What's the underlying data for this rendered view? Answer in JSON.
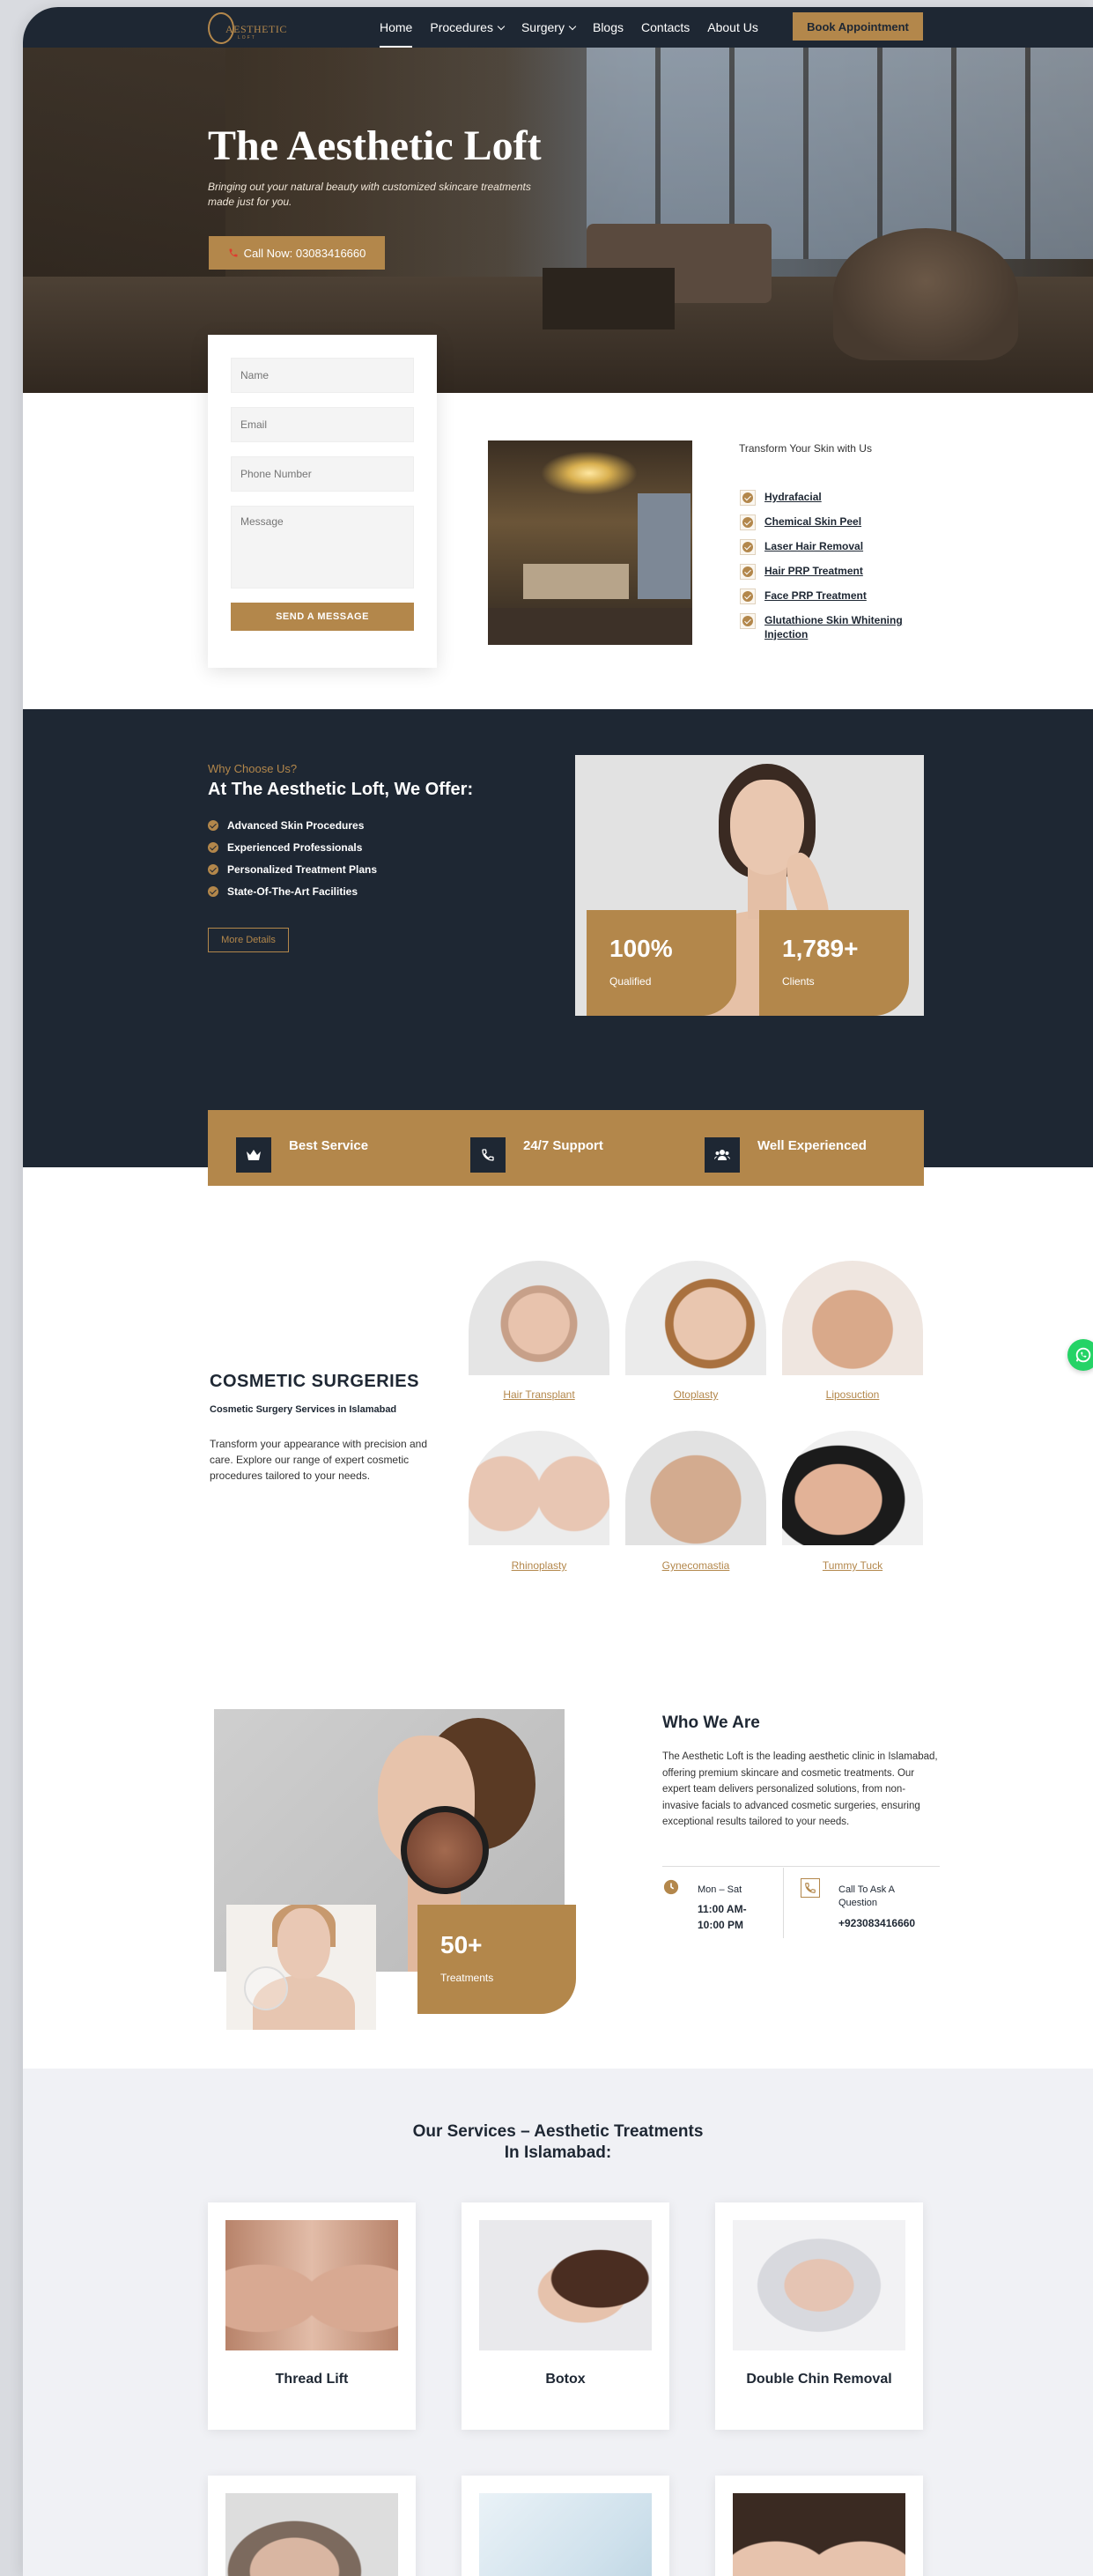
{
  "nav": {
    "logo_text": "AESTHETIC",
    "logo_sub": "LOFT",
    "items": [
      {
        "label": "Home",
        "dropdown": false,
        "active": true
      },
      {
        "label": "Procedures",
        "dropdown": true,
        "active": false
      },
      {
        "label": "Surgery",
        "dropdown": true,
        "active": false
      },
      {
        "label": "Blogs",
        "dropdown": false,
        "active": false
      },
      {
        "label": "Contacts",
        "dropdown": false,
        "active": false
      },
      {
        "label": "About Us",
        "dropdown": false,
        "active": false
      }
    ],
    "book_button": "Book Appointment"
  },
  "hero": {
    "title": "The Aesthetic Loft",
    "subtitle": "Bringing out your natural beauty with customized skincare treatments made just for you.",
    "call_button": "Call Now: 03083416660"
  },
  "form": {
    "name_placeholder": "Name",
    "email_placeholder": "Email",
    "phone_placeholder": "Phone Number",
    "message_placeholder": "Message",
    "send_button": "SEND A MESSAGE"
  },
  "transform": {
    "title": "Transform Your Skin with Us",
    "items": [
      "Hydrafacial",
      "Chemical Skin Peel",
      "Laser Hair Removal",
      "Hair PRP Treatment",
      "Face PRP Treatment",
      "Glutathione Skin Whitening Injection"
    ]
  },
  "why": {
    "eyebrow": "Why Choose Us?",
    "title": "At The Aesthetic Loft, We Offer:",
    "items": [
      "Advanced Skin Procedures",
      "Experienced Professionals",
      "Personalized Treatment Plans",
      "State-Of-The-Art Facilities"
    ],
    "more_button": "More Details",
    "stats": [
      {
        "value": "100%",
        "label": "Qualified"
      },
      {
        "value": "1,789+",
        "label": "Clients"
      }
    ]
  },
  "features": [
    {
      "label": "Best Service",
      "icon": "crown-icon"
    },
    {
      "label": "24/7 Support",
      "icon": "phone-icon"
    },
    {
      "label": "Well Experienced",
      "icon": "users-icon"
    }
  ],
  "surgeries": {
    "title": "COSMETIC SURGERIES",
    "subtitle": "Cosmetic Surgery Services in Islamabad",
    "description": "Transform your appearance with precision and care. Explore our range of expert cosmetic procedures tailored to your needs.",
    "items": [
      "Hair Transplant",
      "Otoplasty",
      "Liposuction",
      "Rhinoplasty",
      "Gynecomastia",
      "Tummy Tuck"
    ]
  },
  "who": {
    "title": "Who We Are",
    "description": "The Aesthetic Loft is the leading aesthetic clinic in Islamabad, offering premium skincare and cosmetic treatments. Our expert team delivers personalized solutions, from non-invasive facials to advanced cosmetic surgeries, ensuring exceptional results tailored to your needs.",
    "stat_value": "50+",
    "stat_label": "Treatments",
    "hours_label": "Mon – Sat",
    "hours_value": "11:00 AM-10:00 PM",
    "call_label": "Call To Ask A Question",
    "call_value": "+923083416660"
  },
  "services": {
    "title_line1": "Our Services – Aesthetic Treatments",
    "title_line2": "In Islamabad:",
    "items": [
      "Thread Lift",
      "Botox",
      "Double Chin Removal"
    ]
  },
  "colors": {
    "accent": "#b3874b",
    "dark": "#1e2733",
    "whatsapp": "#25d366"
  }
}
